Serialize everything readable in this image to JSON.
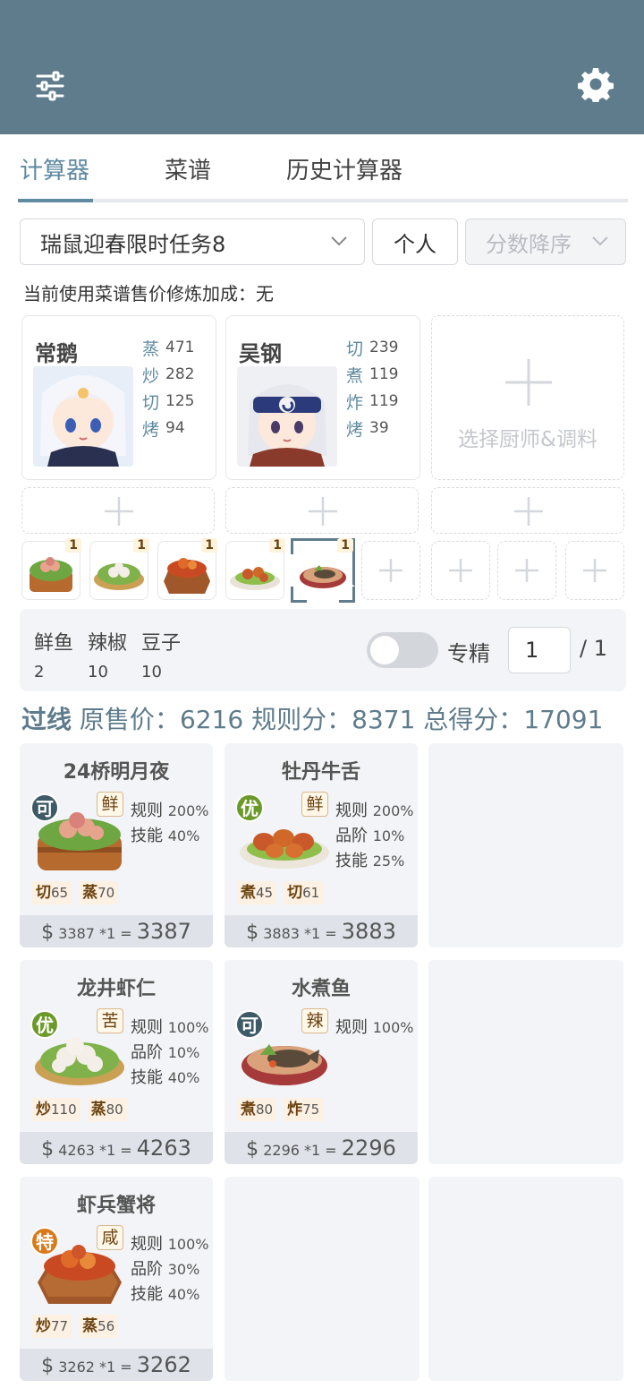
{
  "header": {
    "menu_icon": "sliders-icon",
    "settings_icon": "gear-icon"
  },
  "tabs": [
    {
      "label": "计算器"
    },
    {
      "label": "菜谱"
    },
    {
      "label": "历史计算器"
    }
  ],
  "controls": {
    "rule_select": "瑞鼠迎春限时任务8",
    "mode": "个人",
    "sort": "分数降序"
  },
  "note": "当前使用菜谱售价修炼加成：无",
  "chefs": [
    {
      "name": "常鹅",
      "skills": [
        {
          "label": "蒸",
          "value": "471"
        },
        {
          "label": "炒",
          "value": "282"
        },
        {
          "label": "切",
          "value": "125"
        },
        {
          "label": "烤",
          "value": "94"
        }
      ]
    },
    {
      "name": "吴钢",
      "skills": [
        {
          "label": "切",
          "value": "239"
        },
        {
          "label": "煮",
          "value": "119"
        },
        {
          "label": "炸",
          "value": "119"
        },
        {
          "label": "烤",
          "value": "39"
        }
      ]
    }
  ],
  "add_chef_label": "选择厨师&调料",
  "dish_counts": [
    "1",
    "1",
    "1",
    "1",
    "1"
  ],
  "ingredients": [
    {
      "name": "鲜鱼",
      "qty": "2"
    },
    {
      "name": "辣椒",
      "qty": "10"
    },
    {
      "name": "豆子",
      "qty": "10"
    }
  ],
  "specialize": {
    "label": "专精",
    "value": "1",
    "total": "/ 1",
    "enabled": false
  },
  "score": {
    "status": "过线",
    "orig_label": "原售价：",
    "orig": "6216",
    "rule_label": "规则分：",
    "rule": "8371",
    "total_label": "总得分：",
    "total": "17091"
  },
  "recipes": [
    {
      "name": "24桥明月夜",
      "grade": "可",
      "taste": "鲜",
      "rules": [
        {
          "k": "规则",
          "v": "200%"
        },
        {
          "k": "技能",
          "v": "40%"
        }
      ],
      "req": [
        {
          "k": "切",
          "v": "65"
        },
        {
          "k": "蒸",
          "v": "70"
        }
      ],
      "price": "3387 *1",
      "total": "3387"
    },
    {
      "name": "牡丹牛舌",
      "grade": "优",
      "taste": "鲜",
      "rules": [
        {
          "k": "规则",
          "v": "200%"
        },
        {
          "k": "品阶",
          "v": "10%"
        },
        {
          "k": "技能",
          "v": "25%"
        }
      ],
      "req": [
        {
          "k": "煮",
          "v": "45"
        },
        {
          "k": "切",
          "v": "61"
        }
      ],
      "price": "3883 *1",
      "total": "3883"
    },
    {
      "name": "龙井虾仁",
      "grade": "优",
      "taste": "苦",
      "rules": [
        {
          "k": "规则",
          "v": "100%"
        },
        {
          "k": "品阶",
          "v": "10%"
        },
        {
          "k": "技能",
          "v": "40%"
        }
      ],
      "req": [
        {
          "k": "炒",
          "v": "110"
        },
        {
          "k": "蒸",
          "v": "80"
        }
      ],
      "price": "4263 *1",
      "total": "4263"
    },
    {
      "name": "水煮鱼",
      "grade": "可",
      "taste": "辣",
      "rules": [
        {
          "k": "规则",
          "v": "100%"
        }
      ],
      "req": [
        {
          "k": "煮",
          "v": "80"
        },
        {
          "k": "炸",
          "v": "75"
        }
      ],
      "price": "2296 *1",
      "total": "2296"
    },
    {
      "name": "虾兵蟹将",
      "grade": "特",
      "taste": "咸",
      "rules": [
        {
          "k": "规则",
          "v": "100%"
        },
        {
          "k": "品阶",
          "v": "30%"
        },
        {
          "k": "技能",
          "v": "40%"
        }
      ],
      "req": [
        {
          "k": "炒",
          "v": "77"
        },
        {
          "k": "蒸",
          "v": "56"
        }
      ],
      "price": "3262 *1",
      "total": "3262"
    }
  ],
  "colors": {
    "header": "#5f7c8c",
    "accent": "#5f8aa0",
    "grade_ke": "#3d5a66",
    "grade_you": "#6b9a2a",
    "grade_te": "#d97a1a"
  }
}
